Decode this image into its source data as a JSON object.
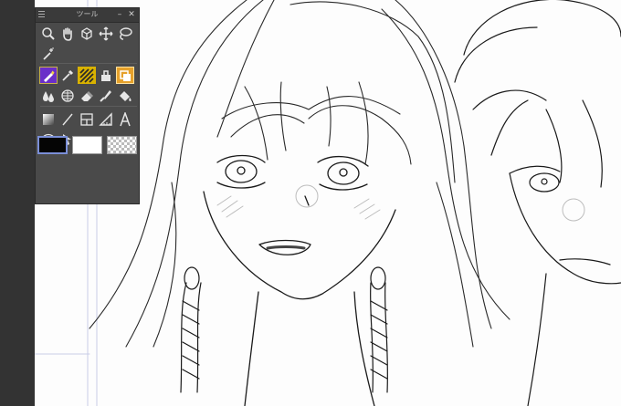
{
  "panel": {
    "title": "ツール",
    "minimize_label": "–",
    "close_label": "✕"
  },
  "tools": [
    [
      "zoom-icon",
      "hand-icon",
      "rotate-icon",
      "move-icon",
      "lasso-icon"
    ],
    [
      "magic-wand-icon"
    ],
    [
      "pen-icon",
      "eyedropper-icon",
      "decoration-icon",
      "text-stamp-icon",
      "fill-icon"
    ],
    [
      "blend-icon",
      "grid-icon",
      "eraser-icon",
      "brush-icon",
      "bucket-icon"
    ],
    [
      "gradient-icon",
      "line-icon",
      "frame-icon",
      "ruler-icon",
      "text-icon"
    ],
    [
      "balloon-icon",
      "operation-icon"
    ]
  ],
  "colors": {
    "main_color": "#050505",
    "sub_color": "#ffffff",
    "selected_pen_bg": "#6a2fc9",
    "panel_bg": "#4a4a4a"
  }
}
